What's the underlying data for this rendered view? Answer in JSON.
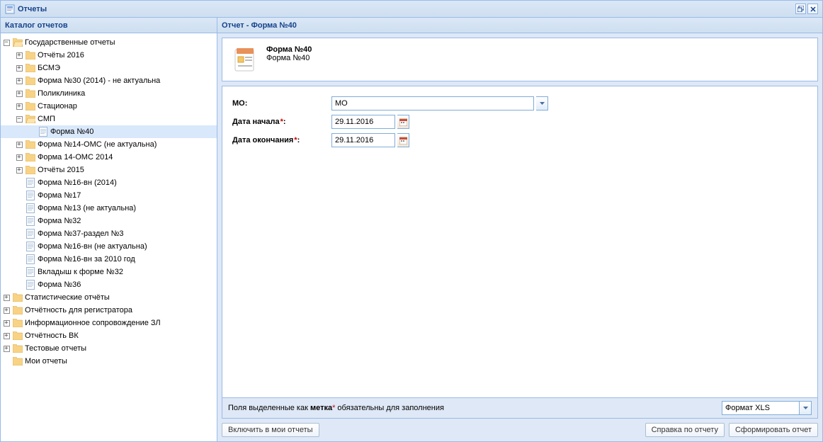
{
  "window": {
    "title": "Отчеты"
  },
  "left": {
    "header": "Каталог отчетов"
  },
  "tree": {
    "root": "Государственные отчеты",
    "n0": "Отчёты 2016",
    "n1": "БСМЭ",
    "n2": "Форма №30 (2014) - не актуальна",
    "n3": "Поликлиника",
    "n4": "Стационар",
    "n5": "СМП",
    "n5_0": "Форма №40",
    "n6": "Форма №14-ОМС (не актуальна)",
    "n7": "Форма 14-ОМС 2014",
    "n8": "Отчёты 2015",
    "n9": "Форма №16-вн (2014)",
    "n10": "Форма №17",
    "n11": "Форма №13 (не актуальна)",
    "n12": "Форма №32",
    "n13": "Форма №37-раздел №3",
    "n14": "Форма №16-вн (не актуальна)",
    "n15": "Форма №16-вн за 2010 год",
    "n16": "Вкладыш к форме №32",
    "n17": "Форма №36",
    "r1": "Статистические отчёты",
    "r2": "Отчётность для регистратора",
    "r3": "Информационное сопровождение ЗЛ",
    "r4": "Отчётность ВК",
    "r5": "Тестовые отчеты",
    "r6": "Мои отчеты"
  },
  "right": {
    "header": "Отчет - Форма №40",
    "desc_title": "Форма №40",
    "desc_sub": "Форма №40"
  },
  "form": {
    "mo_label": "МО:",
    "mo_value": "МО",
    "start_label": "Дата начала",
    "start_value": "29.11.2016",
    "end_label": "Дата окончания",
    "end_value": "29.11.2016"
  },
  "hint": {
    "p1": "Поля выделенные как ",
    "p2": "метка",
    "p3": " обязательны для заполнения",
    "format": "Формат XLS"
  },
  "buttons": {
    "include": "Включить в мои отчеты",
    "help": "Справка по отчету",
    "generate": "Сформировать отчет"
  }
}
